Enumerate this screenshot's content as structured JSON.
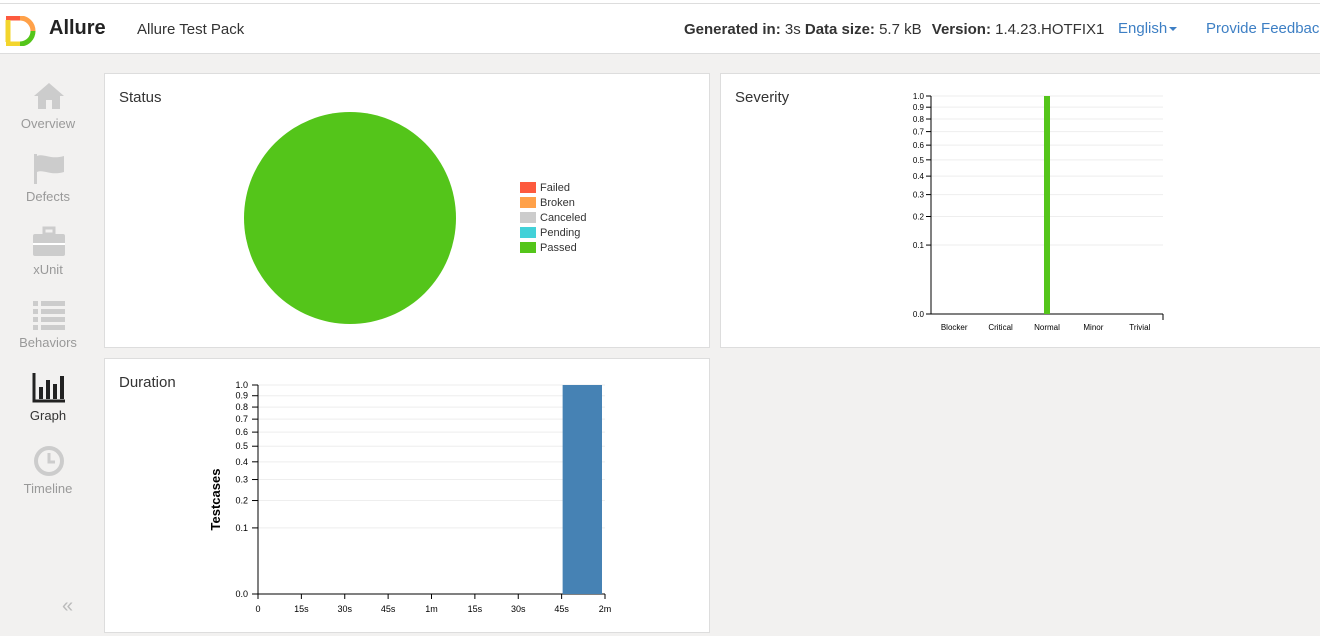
{
  "header": {
    "brand": "Allure",
    "report_name": "Allure Test Pack",
    "generated_label": "Generated in:",
    "generated_value": "3s",
    "size_label": "Data size:",
    "size_value": "5.7 kB",
    "version_label": "Version:",
    "version_value": "1.4.23.HOTFIX1",
    "language": "English",
    "feedback": "Provide Feedback"
  },
  "sidebar": {
    "items": [
      {
        "label": "Overview",
        "icon": "home-icon"
      },
      {
        "label": "Defects",
        "icon": "flag-icon"
      },
      {
        "label": "xUnit",
        "icon": "briefcase-icon"
      },
      {
        "label": "Behaviors",
        "icon": "list-icon"
      },
      {
        "label": "Graph",
        "icon": "bar-chart-icon",
        "active": true
      },
      {
        "label": "Timeline",
        "icon": "clock-icon"
      }
    ],
    "collapse": "«"
  },
  "panels": {
    "status": {
      "title": "Status"
    },
    "severity": {
      "title": "Severity"
    },
    "duration": {
      "title": "Duration"
    }
  },
  "colors": {
    "failed": "#fd5a3e",
    "broken": "#ffa149",
    "canceled": "#cccccc",
    "pending": "#42d1d8",
    "passed": "#54c51a",
    "duration_bar": "#4682b4"
  },
  "chart_data": [
    {
      "type": "pie",
      "title": "Status",
      "labels": [
        "Failed",
        "Broken",
        "Canceled",
        "Pending",
        "Passed"
      ],
      "values": [
        0,
        0,
        0,
        0,
        1
      ]
    },
    {
      "type": "bar",
      "title": "Severity",
      "categories": [
        "Blocker",
        "Critical",
        "Normal",
        "Minor",
        "Trivial"
      ],
      "values": [
        0,
        0,
        1,
        0,
        0
      ],
      "yticks": [
        "0.0",
        "0.1",
        "0.2",
        "0.3",
        "0.4",
        "0.5",
        "0.6",
        "0.7",
        "0.8",
        "0.9",
        "1.0"
      ],
      "ylim": [
        0,
        1
      ]
    },
    {
      "type": "bar",
      "title": "Duration",
      "ylabel": "Testcases",
      "xticks": [
        "0",
        "15s",
        "30s",
        "45s",
        "1m",
        "15s",
        "30s",
        "45s",
        "2m"
      ],
      "bins": [
        {
          "from": "1m 45s",
          "to": "2m",
          "value": 1
        }
      ],
      "yticks": [
        "0.0",
        "0.1",
        "0.2",
        "0.3",
        "0.4",
        "0.5",
        "0.6",
        "0.7",
        "0.8",
        "0.9",
        "1.0"
      ],
      "ylim": [
        0,
        1
      ]
    }
  ]
}
